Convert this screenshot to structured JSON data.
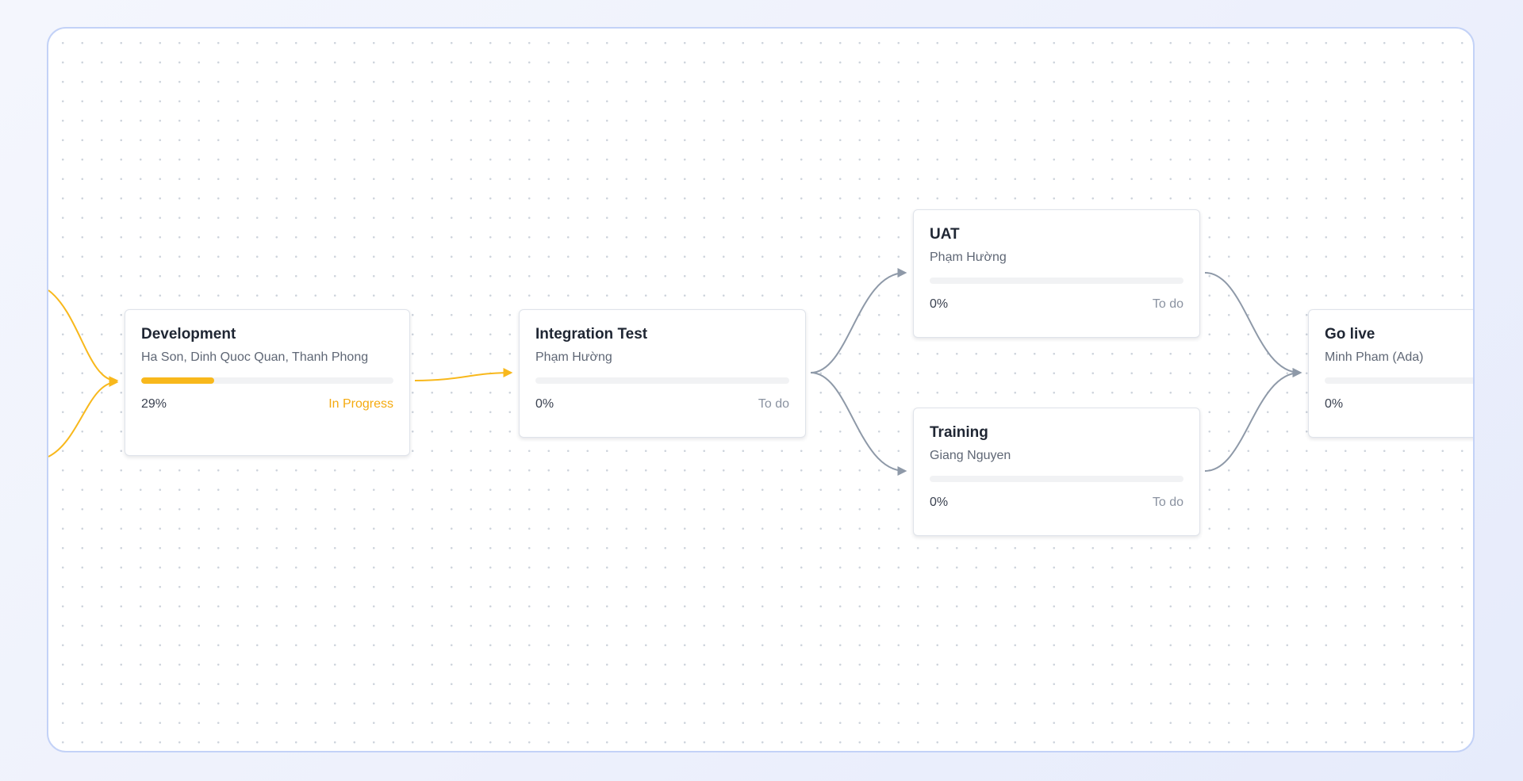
{
  "nodes": {
    "development": {
      "title": "Development",
      "assignee": "Ha Son, Dinh Quoc Quan, Thanh Phong",
      "progress": 29,
      "percent_label": "29%",
      "status": "In Progress"
    },
    "integration_test": {
      "title": "Integration Test",
      "assignee": "Phạm Hường",
      "progress": 0,
      "percent_label": "0%",
      "status": "To do"
    },
    "uat": {
      "title": "UAT",
      "assignee": "Phạm Hường",
      "progress": 0,
      "percent_label": "0%",
      "status": "To do"
    },
    "training": {
      "title": "Training",
      "assignee": "Giang Nguyen",
      "progress": 0,
      "percent_label": "0%",
      "status": "To do"
    },
    "go_live": {
      "title": "Go live",
      "assignee": "Minh Pham (Ada)",
      "progress": 0,
      "percent_label": "0%",
      "status": ""
    }
  },
  "edges": [
    {
      "from": "upstream-top",
      "to": "development",
      "state": "active"
    },
    {
      "from": "upstream-bottom",
      "to": "development",
      "state": "active"
    },
    {
      "from": "development",
      "to": "integration_test",
      "state": "active"
    },
    {
      "from": "integration_test",
      "to": "uat",
      "state": "idle"
    },
    {
      "from": "integration_test",
      "to": "training",
      "state": "idle"
    },
    {
      "from": "uat",
      "to": "go_live",
      "state": "idle"
    },
    {
      "from": "training",
      "to": "go_live",
      "state": "idle"
    }
  ],
  "colors": {
    "active": "#f8b81c",
    "idle": "#8e99a8",
    "board_border": "#c3d2f7"
  }
}
